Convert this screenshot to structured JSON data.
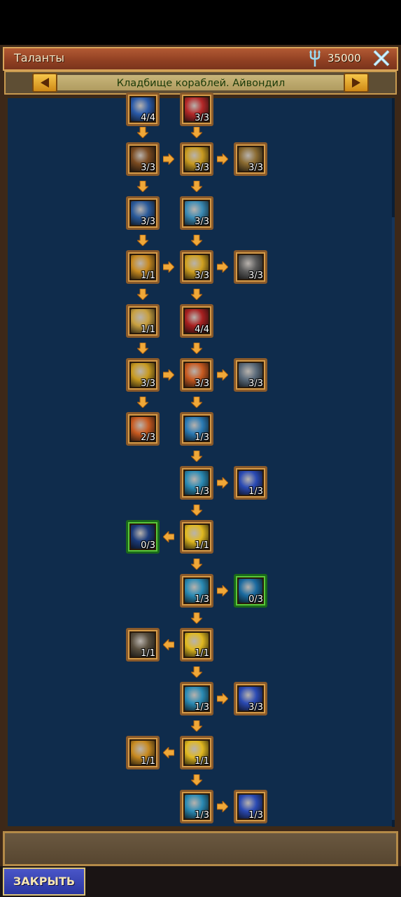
{
  "header": {
    "title": "Таланты",
    "currency_icon": "trident-icon",
    "currency_value": "35000",
    "close_icon": "close-x-icon"
  },
  "nav": {
    "location": "Кладбище кораблей. Айвондил",
    "prev_icon": "arrow-left-icon",
    "next_icon": "arrow-right-icon"
  },
  "tree": {
    "nodes": [
      {
        "level": "4/4",
        "color": "#2a5aa8"
      },
      {
        "level": "3/3",
        "color": "#b42828"
      },
      {
        "level": "3/3",
        "color": "#7a4a20"
      },
      {
        "level": "3/3",
        "color": "#c89a20"
      },
      {
        "level": "3/3",
        "color": "#8a6a30"
      },
      {
        "level": "3/3",
        "color": "#2a5a9a"
      },
      {
        "level": "3/3",
        "color": "#3a8ab4"
      },
      {
        "level": "1/1",
        "color": "#c88a20"
      },
      {
        "level": "3/3",
        "color": "#d0a020"
      },
      {
        "level": "3/3",
        "color": "#5a5a5a"
      },
      {
        "level": "1/1",
        "color": "#c8a040"
      },
      {
        "level": "4/4",
        "color": "#a82020"
      },
      {
        "level": "3/3",
        "color": "#c89a20"
      },
      {
        "level": "3/3",
        "color": "#c85a20"
      },
      {
        "level": "3/3",
        "color": "#5a6a7a"
      },
      {
        "level": "2/3",
        "color": "#c85a20"
      },
      {
        "level": "1/3",
        "color": "#2a7ab4"
      },
      {
        "level": "1/3",
        "color": "#2a8ab4"
      },
      {
        "level": "1/3",
        "color": "#2a4ab4"
      },
      {
        "level": "0/3",
        "color": "#1a3a7a"
      },
      {
        "level": "1/1",
        "color": "#e0b820"
      },
      {
        "level": "1/3",
        "color": "#2a8ab4"
      },
      {
        "level": "0/3",
        "color": "#1a6aa0"
      },
      {
        "level": "1/1",
        "color": "#5a5040"
      },
      {
        "level": "1/1",
        "color": "#e0b820"
      },
      {
        "level": "1/3",
        "color": "#2a8ab4"
      },
      {
        "level": "3/3",
        "color": "#2a4ab4"
      },
      {
        "level": "1/1",
        "color": "#c88a20"
      },
      {
        "level": "1/1",
        "color": "#e0b820"
      },
      {
        "level": "1/3",
        "color": "#2a8ab4"
      },
      {
        "level": "1/3",
        "color": "#2a4ab4"
      }
    ]
  },
  "footer": {
    "close_label": "ЗАКРЫТЬ"
  }
}
